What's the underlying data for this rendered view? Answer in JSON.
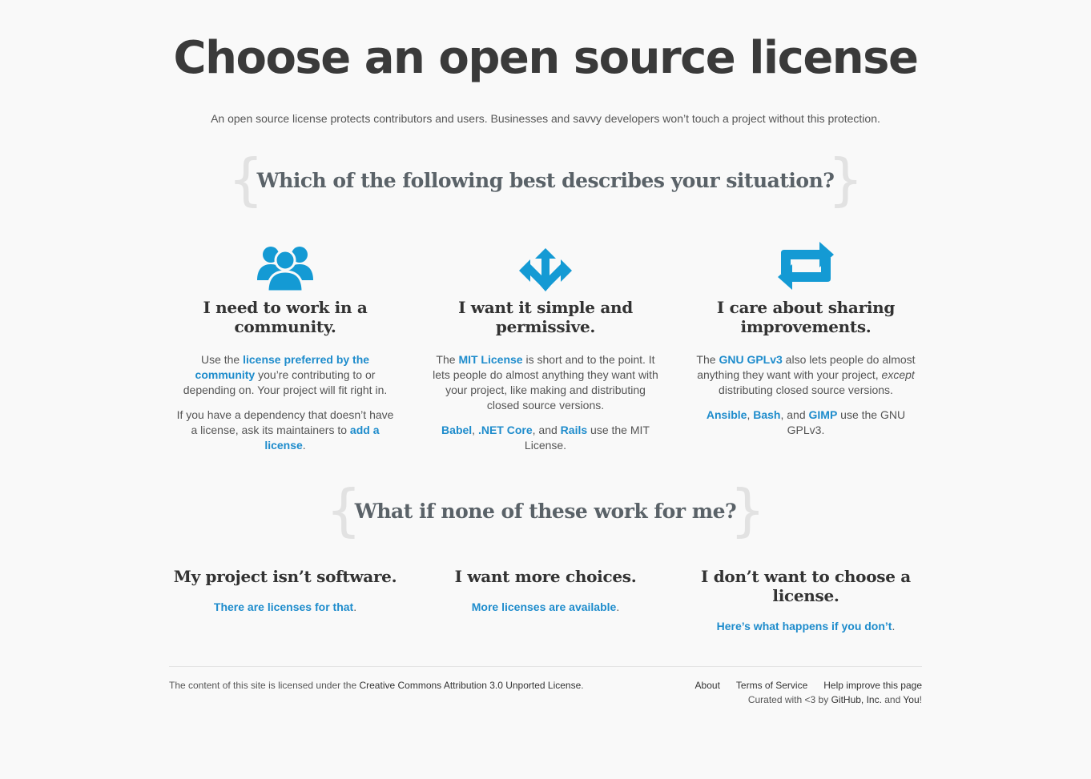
{
  "header": {
    "title": "Choose an open source license",
    "lead": "An open source license protects contributors and users. Businesses and savvy developers won’t touch a project without this protection."
  },
  "question1": {
    "heading": "Which of the following best describes your situation?"
  },
  "options": [
    {
      "icon": "users-icon",
      "heading": "I need to work in a community.",
      "p1_pre": "Use the ",
      "p1_link": "license preferred by the community",
      "p1_post": " you’re contributing to or depending on. Your project will fit right in.",
      "p2_pre": "If you have a dependency that doesn’t have a license, ask its maintainers to ",
      "p2_link": "add a license",
      "p2_post": "."
    },
    {
      "icon": "arrows-split-icon",
      "heading": "I want it simple and permissive.",
      "p1_pre": "The ",
      "p1_link": "MIT License",
      "p1_post": " is short and to the point. It lets people do almost anything they want with your project, like making and distributing closed source versions.",
      "p2_link1": "Babel",
      "p2_sep1": ", ",
      "p2_link2": ".NET Core",
      "p2_sep2": ", and ",
      "p2_link3": "Rails",
      "p2_post": " use the MIT License."
    },
    {
      "icon": "repeat-icon",
      "heading": "I care about sharing improvements.",
      "p1_pre": "The ",
      "p1_link": "GNU GPLv3",
      "p1_post": " also lets people do almost anything they want with your project, ",
      "p1_em": "except",
      "p1_post2": " distributing closed source versions.",
      "p2_link1": "Ansible",
      "p2_sep1": ", ",
      "p2_link2": "Bash",
      "p2_sep2": ", and ",
      "p2_link3": "GIMP",
      "p2_post": " use the GNU GPLv3."
    }
  ],
  "question2": {
    "heading": "What if none of these work for me?"
  },
  "alternatives": [
    {
      "heading": "My project isn’t software.",
      "link": "There are licenses for that",
      "post": "."
    },
    {
      "heading": "I want more choices.",
      "link": "More licenses are available",
      "post": "."
    },
    {
      "heading": "I don’t want to choose a license.",
      "link": "Here’s what happens if you don’t",
      "post": "."
    }
  ],
  "footer": {
    "license_pre": "The content of this site is licensed under the ",
    "license_link": "Creative Commons Attribution 3.0 Unported License",
    "license_post": ".",
    "links": [
      "About",
      "Terms of Service",
      "Help improve this page"
    ],
    "curated_pre": "Curated with <3 by ",
    "curated_link": "GitHub, Inc.",
    "curated_mid": " and ",
    "curated_link2": "You",
    "curated_post": "!"
  },
  "colors": {
    "accent": "#1e8ccc",
    "icon": "#149ad4",
    "heading": "#3a3a3a"
  }
}
